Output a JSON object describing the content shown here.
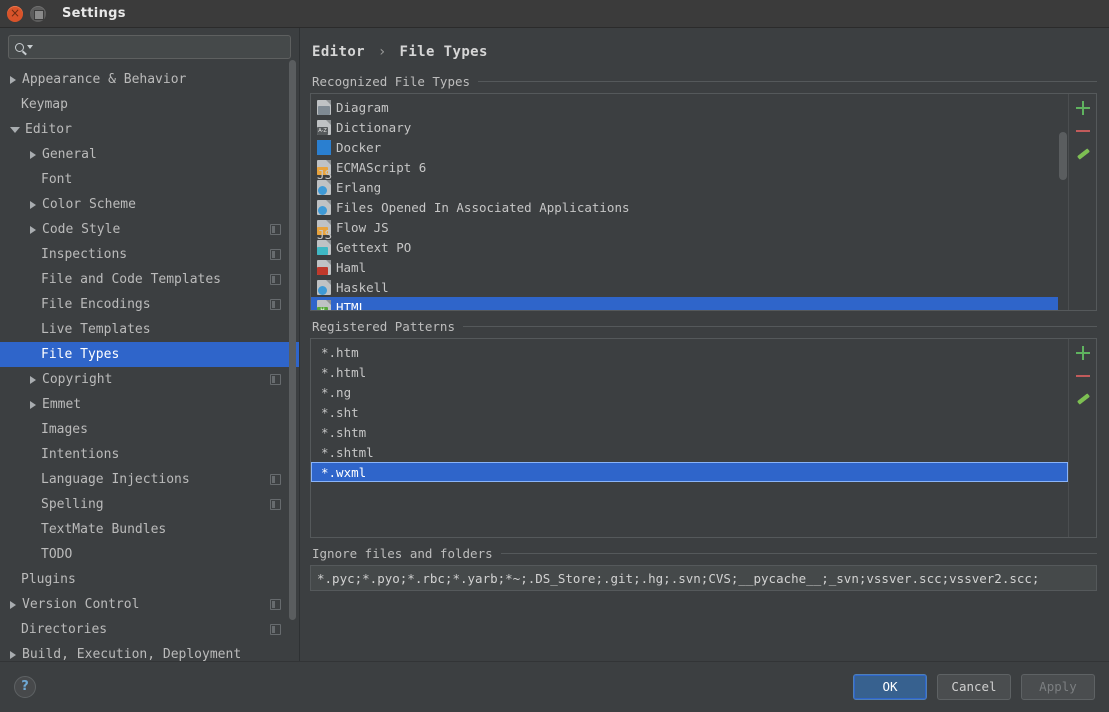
{
  "window": {
    "title": "Settings",
    "close_icon": "close-icon",
    "maximize_icon": "maximize-icon"
  },
  "search": {
    "value": "",
    "placeholder": "",
    "icon": "search-icon"
  },
  "sidebar": {
    "items": [
      {
        "label": "Appearance & Behavior",
        "indent": 0,
        "arrow": "closed",
        "selected": false,
        "config": false
      },
      {
        "label": "Keymap",
        "indent": 0,
        "arrow": "none",
        "selected": false,
        "config": false
      },
      {
        "label": "Editor",
        "indent": 0,
        "arrow": "open",
        "selected": false,
        "config": false
      },
      {
        "label": "General",
        "indent": 1,
        "arrow": "closed",
        "selected": false,
        "config": false
      },
      {
        "label": "Font",
        "indent": 1,
        "arrow": "none",
        "selected": false,
        "config": false
      },
      {
        "label": "Color Scheme",
        "indent": 1,
        "arrow": "closed",
        "selected": false,
        "config": false
      },
      {
        "label": "Code Style",
        "indent": 1,
        "arrow": "closed",
        "selected": false,
        "config": true
      },
      {
        "label": "Inspections",
        "indent": 1,
        "arrow": "none",
        "selected": false,
        "config": true
      },
      {
        "label": "File and Code Templates",
        "indent": 1,
        "arrow": "none",
        "selected": false,
        "config": true
      },
      {
        "label": "File Encodings",
        "indent": 1,
        "arrow": "none",
        "selected": false,
        "config": true
      },
      {
        "label": "Live Templates",
        "indent": 1,
        "arrow": "none",
        "selected": false,
        "config": false
      },
      {
        "label": "File Types",
        "indent": 1,
        "arrow": "none",
        "selected": true,
        "config": false
      },
      {
        "label": "Copyright",
        "indent": 1,
        "arrow": "closed",
        "selected": false,
        "config": true
      },
      {
        "label": "Emmet",
        "indent": 1,
        "arrow": "closed",
        "selected": false,
        "config": false
      },
      {
        "label": "Images",
        "indent": 1,
        "arrow": "none",
        "selected": false,
        "config": false
      },
      {
        "label": "Intentions",
        "indent": 1,
        "arrow": "none",
        "selected": false,
        "config": false
      },
      {
        "label": "Language Injections",
        "indent": 1,
        "arrow": "none",
        "selected": false,
        "config": true
      },
      {
        "label": "Spelling",
        "indent": 1,
        "arrow": "none",
        "selected": false,
        "config": true
      },
      {
        "label": "TextMate Bundles",
        "indent": 1,
        "arrow": "none",
        "selected": false,
        "config": false
      },
      {
        "label": "TODO",
        "indent": 1,
        "arrow": "none",
        "selected": false,
        "config": false
      },
      {
        "label": "Plugins",
        "indent": 0,
        "arrow": "none",
        "selected": false,
        "config": false
      },
      {
        "label": "Version Control",
        "indent": 0,
        "arrow": "closed",
        "selected": false,
        "config": true
      },
      {
        "label": "Directories",
        "indent": 0,
        "arrow": "none",
        "selected": false,
        "config": true
      },
      {
        "label": "Build, Execution, Deployment",
        "indent": 0,
        "arrow": "closed",
        "selected": false,
        "config": false
      }
    ]
  },
  "main": {
    "breadcrumb": {
      "parent": "Editor",
      "separator": "›",
      "current": "File Types"
    },
    "recognized": {
      "title": "Recognized File Types",
      "items": [
        {
          "label": "Diagram",
          "icon": "diagram-file-icon",
          "badge": "tree",
          "badge_text": "",
          "selected": false
        },
        {
          "label": "Dictionary",
          "icon": "dictionary-file-icon",
          "badge": "az",
          "badge_text": "A-Z",
          "selected": false
        },
        {
          "label": "Docker",
          "icon": "docker-file-icon",
          "badge": "docker",
          "badge_text": "",
          "selected": false
        },
        {
          "label": "ECMAScript 6",
          "icon": "ecmascript-file-icon",
          "badge": "js",
          "badge_text": "JS",
          "selected": false
        },
        {
          "label": "Erlang",
          "icon": "erlang-file-icon",
          "badge": "globe",
          "badge_text": "",
          "selected": false
        },
        {
          "label": "Files Opened In Associated Applications",
          "icon": "associated-file-icon",
          "badge": "globe",
          "badge_text": "",
          "selected": false
        },
        {
          "label": "Flow JS",
          "icon": "flowjs-file-icon",
          "badge": "js",
          "badge_text": "JS",
          "selected": false
        },
        {
          "label": "Gettext PO",
          "icon": "gettext-file-icon",
          "badge": "po",
          "badge_text": "",
          "selected": false
        },
        {
          "label": "Haml",
          "icon": "haml-file-icon",
          "badge": "haml",
          "badge_text": "",
          "selected": false
        },
        {
          "label": "Haskell",
          "icon": "haskell-file-icon",
          "badge": "globe",
          "badge_text": "",
          "selected": false
        },
        {
          "label": "HTML",
          "icon": "html-file-icon",
          "badge": "html",
          "badge_text": "H",
          "selected": true
        }
      ],
      "toolbar": [
        {
          "name": "add-file-type-button",
          "icon": "plus-icon",
          "enabled": true
        },
        {
          "name": "remove-file-type-button",
          "icon": "minus-icon",
          "enabled": false
        },
        {
          "name": "edit-file-type-button",
          "icon": "pencil-icon",
          "enabled": false
        }
      ]
    },
    "patterns": {
      "title": "Registered Patterns",
      "items": [
        {
          "label": "*.htm",
          "selected": false
        },
        {
          "label": "*.html",
          "selected": false
        },
        {
          "label": "*.ng",
          "selected": false
        },
        {
          "label": "*.sht",
          "selected": false
        },
        {
          "label": "*.shtm",
          "selected": false
        },
        {
          "label": "*.shtml",
          "selected": false
        },
        {
          "label": "*.wxml",
          "selected": true
        }
      ],
      "toolbar": [
        {
          "name": "add-pattern-button",
          "icon": "plus-icon",
          "enabled": true
        },
        {
          "name": "remove-pattern-button",
          "icon": "minus-icon",
          "enabled": true
        },
        {
          "name": "edit-pattern-button",
          "icon": "pencil-icon",
          "enabled": true
        }
      ]
    },
    "ignore": {
      "title": "Ignore files and folders",
      "value": "*.pyc;*.pyo;*.rbc;*.yarb;*~;.DS_Store;.git;.hg;.svn;CVS;__pycache__;_svn;vssver.scc;vssver2.scc;"
    }
  },
  "footer": {
    "help_label": "?",
    "ok_label": "OK",
    "cancel_label": "Cancel",
    "apply_label": "Apply",
    "apply_enabled": false
  },
  "colors": {
    "accent": "#2f65ca",
    "panel": "#3c3f41",
    "border": "#55595b",
    "text": "#c6c6c6",
    "plus": "#5fb35f",
    "minus": "#c25b5b"
  }
}
